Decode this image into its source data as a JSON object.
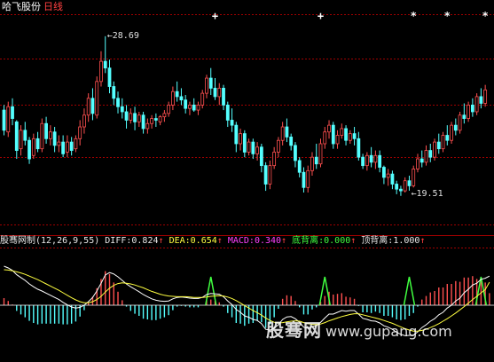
{
  "header": {
    "stock_name": "哈飞股份",
    "period": "日线"
  },
  "indicator": {
    "name": "股骞网制",
    "params": "(12,26,9,55)",
    "diff_label": "DIFF:",
    "diff_value": "0.824",
    "dea_label": "DEA:",
    "dea_value": "0.654",
    "macd_label": "MACD:",
    "macd_value": "0.340",
    "bottom_div_label": "底背离:",
    "bottom_div_value": "0.000",
    "top_div_label": "顶背离:",
    "top_div_value": "1.000",
    "up_arrow": "↑"
  },
  "watermark": {
    "cn": "股骞网",
    "url": "www.gupang.com"
  },
  "colors": {
    "up": "#ff5050",
    "down": "#54ffff",
    "grid": "#a00000",
    "diff": "#ffffff",
    "dea": "#ffff40",
    "signal": "#40ff40"
  },
  "chart_data": [
    {
      "type": "candlestick",
      "title": "",
      "ylim": [
        17.5,
        30.0
      ],
      "annotations": [
        {
          "text": "28.69",
          "value": 28.69,
          "kind": "max"
        },
        {
          "text": "19.51",
          "value": 19.51,
          "kind": "min"
        }
      ],
      "markers": [
        {
          "symbol": "+",
          "bars": [
            50,
            75
          ]
        },
        {
          "symbol": "*",
          "bars": [
            97,
            105,
            114
          ]
        }
      ],
      "ohlc": [
        [
          24.3,
          24.6,
          22.8,
          23.1
        ],
        [
          23.0,
          24.8,
          22.7,
          24.5
        ],
        [
          24.5,
          25.0,
          23.4,
          23.8
        ],
        [
          23.6,
          23.7,
          21.4,
          21.9
        ],
        [
          22.0,
          23.4,
          21.6,
          23.1
        ],
        [
          23.1,
          23.6,
          22.2,
          22.5
        ],
        [
          22.5,
          22.7,
          21.1,
          21.4
        ],
        [
          21.6,
          22.9,
          21.4,
          22.6
        ],
        [
          22.6,
          23.0,
          21.8,
          22.0
        ],
        [
          22.0,
          23.8,
          21.8,
          23.5
        ],
        [
          23.5,
          23.9,
          22.3,
          22.6
        ],
        [
          22.6,
          23.4,
          22.2,
          23.0
        ],
        [
          23.0,
          23.3,
          21.8,
          22.2
        ],
        [
          22.2,
          22.8,
          21.8,
          22.4
        ],
        [
          22.4,
          22.8,
          21.5,
          21.7
        ],
        [
          21.8,
          22.8,
          21.5,
          22.4
        ],
        [
          22.4,
          22.7,
          21.6,
          21.9
        ],
        [
          22.0,
          22.8,
          21.8,
          22.6
        ],
        [
          22.6,
          23.7,
          22.2,
          23.3
        ],
        [
          23.3,
          24.4,
          22.9,
          24.0
        ],
        [
          24.0,
          25.3,
          23.6,
          25.0
        ],
        [
          25.0,
          25.6,
          23.7,
          24.1
        ],
        [
          24.0,
          26.3,
          23.8,
          26.0
        ],
        [
          26.0,
          27.8,
          25.7,
          27.2
        ],
        [
          27.2,
          28.69,
          26.5,
          26.8
        ],
        [
          26.8,
          27.3,
          25.3,
          25.7
        ],
        [
          25.7,
          26.0,
          24.6,
          25.0
        ],
        [
          25.0,
          25.4,
          24.1,
          24.5
        ],
        [
          24.5,
          25.0,
          23.8,
          24.2
        ],
        [
          24.2,
          24.6,
          23.2,
          23.7
        ],
        [
          23.7,
          24.4,
          23.5,
          24.1
        ],
        [
          24.1,
          24.5,
          23.1,
          23.6
        ],
        [
          23.6,
          24.2,
          23.3,
          24.0
        ],
        [
          24.0,
          24.2,
          22.9,
          23.2
        ],
        [
          23.2,
          23.8,
          22.9,
          23.5
        ],
        [
          23.5,
          24.0,
          23.2,
          23.8
        ],
        [
          23.8,
          24.1,
          23.3,
          23.7
        ],
        [
          23.6,
          24.0,
          23.4,
          23.9
        ],
        [
          23.9,
          24.3,
          23.6,
          24.1
        ],
        [
          24.1,
          24.8,
          23.9,
          24.6
        ],
        [
          24.6,
          25.7,
          24.3,
          25.4
        ],
        [
          25.4,
          26.0,
          24.8,
          25.1
        ],
        [
          25.1,
          25.6,
          24.6,
          24.9
        ],
        [
          24.9,
          25.2,
          24.1,
          24.4
        ],
        [
          24.4,
          24.8,
          24.0,
          24.6
        ],
        [
          24.6,
          25.0,
          24.2,
          24.3
        ],
        [
          24.3,
          24.8,
          24.0,
          24.6
        ],
        [
          24.6,
          25.5,
          24.4,
          25.3
        ],
        [
          25.3,
          26.4,
          25.0,
          26.2
        ],
        [
          26.2,
          26.8,
          25.2,
          25.6
        ],
        [
          25.6,
          26.2,
          24.9,
          25.1
        ],
        [
          25.1,
          25.9,
          24.6,
          25.6
        ],
        [
          25.6,
          25.8,
          24.3,
          24.6
        ],
        [
          24.6,
          24.8,
          23.3,
          23.7
        ],
        [
          23.7,
          24.4,
          23.0,
          23.4
        ],
        [
          23.4,
          23.6,
          21.8,
          22.3
        ],
        [
          22.3,
          23.2,
          21.9,
          22.9
        ],
        [
          22.9,
          23.1,
          21.5,
          21.8
        ],
        [
          21.8,
          22.6,
          21.6,
          22.4
        ],
        [
          22.4,
          22.6,
          21.4,
          21.7
        ],
        [
          21.7,
          22.4,
          21.3,
          22.1
        ],
        [
          22.1,
          22.3,
          20.6,
          21.0
        ],
        [
          21.0,
          21.2,
          19.5,
          19.9
        ],
        [
          19.9,
          21.3,
          19.6,
          21.0
        ],
        [
          21.0,
          22.1,
          20.8,
          21.8
        ],
        [
          21.8,
          22.7,
          21.5,
          22.5
        ],
        [
          22.5,
          23.6,
          22.2,
          23.3
        ],
        [
          23.3,
          23.8,
          22.4,
          22.7
        ],
        [
          22.7,
          22.9,
          21.9,
          22.2
        ],
        [
          22.2,
          22.4,
          20.9,
          21.3
        ],
        [
          21.3,
          21.5,
          20.3,
          20.6
        ],
        [
          20.6,
          20.9,
          19.4,
          19.7
        ],
        [
          19.7,
          21.0,
          19.4,
          20.7
        ],
        [
          20.7,
          21.8,
          20.4,
          21.5
        ],
        [
          21.5,
          22.3,
          20.8,
          21.1
        ],
        [
          21.1,
          22.6,
          20.9,
          22.3
        ],
        [
          22.3,
          23.3,
          22.0,
          23.0
        ],
        [
          23.0,
          23.7,
          22.6,
          23.4
        ],
        [
          23.4,
          23.6,
          22.0,
          22.3
        ],
        [
          22.3,
          23.1,
          22.0,
          22.8
        ],
        [
          22.8,
          23.5,
          22.6,
          23.2
        ],
        [
          23.2,
          23.4,
          22.2,
          22.5
        ],
        [
          22.5,
          23.1,
          22.3,
          22.9
        ],
        [
          22.9,
          23.3,
          22.2,
          22.6
        ],
        [
          22.6,
          23.0,
          21.3,
          21.5
        ],
        [
          21.5,
          21.7,
          20.8,
          21.0
        ],
        [
          21.0,
          21.8,
          20.7,
          21.6
        ],
        [
          21.6,
          22.1,
          20.9,
          21.2
        ],
        [
          21.2,
          21.9,
          20.8,
          21.6
        ],
        [
          21.6,
          21.9,
          20.6,
          20.9
        ],
        [
          20.9,
          21.0,
          19.9,
          20.3
        ],
        [
          20.3,
          20.8,
          19.8,
          20.5
        ],
        [
          20.5,
          20.7,
          19.6,
          19.9
        ],
        [
          19.9,
          20.1,
          19.3,
          19.6
        ],
        [
          19.6,
          19.8,
          19.2,
          19.5
        ],
        [
          19.5,
          20.3,
          19.4,
          20.1
        ],
        [
          20.1,
          20.4,
          19.51,
          19.8
        ],
        [
          19.8,
          21.0,
          19.7,
          20.8
        ],
        [
          20.8,
          21.7,
          20.6,
          21.4
        ],
        [
          21.4,
          21.9,
          20.9,
          21.2
        ],
        [
          21.2,
          22.2,
          21.0,
          21.9
        ],
        [
          21.9,
          22.3,
          21.2,
          21.5
        ],
        [
          21.5,
          22.6,
          21.3,
          22.4
        ],
        [
          22.4,
          22.9,
          21.7,
          22.0
        ],
        [
          22.0,
          23.0,
          21.8,
          22.8
        ],
        [
          22.8,
          23.4,
          22.2,
          22.5
        ],
        [
          22.5,
          23.6,
          22.3,
          23.4
        ],
        [
          23.4,
          23.8,
          22.8,
          23.1
        ],
        [
          23.1,
          24.2,
          22.9,
          24.0
        ],
        [
          24.0,
          24.7,
          23.5,
          23.8
        ],
        [
          23.8,
          24.8,
          23.6,
          24.6
        ],
        [
          24.6,
          25.0,
          23.9,
          24.2
        ],
        [
          24.2,
          25.3,
          24.0,
          25.1
        ],
        [
          25.1,
          25.6,
          24.4,
          24.7
        ],
        [
          24.7,
          25.8,
          24.5,
          25.5
        ]
      ]
    },
    {
      "type": "macd",
      "ylim": [
        -1.5,
        1.6
      ],
      "series": [
        {
          "name": "DIFF",
          "final": 0.824
        },
        {
          "name": "DEA",
          "final": 0.654
        },
        {
          "name": "MACD",
          "final": 0.34
        }
      ],
      "diff": [
        1.1,
        1.05,
        0.98,
        0.86,
        0.78,
        0.7,
        0.6,
        0.52,
        0.45,
        0.4,
        0.34,
        0.28,
        0.22,
        0.16,
        0.08,
        0.01,
        -0.05,
        -0.08,
        -0.06,
        0.0,
        0.1,
        0.22,
        0.4,
        0.62,
        0.85,
        0.92,
        0.88,
        0.8,
        0.7,
        0.6,
        0.52,
        0.45,
        0.38,
        0.3,
        0.24,
        0.18,
        0.14,
        0.12,
        0.11,
        0.12,
        0.18,
        0.22,
        0.23,
        0.22,
        0.2,
        0.19,
        0.19,
        0.22,
        0.3,
        0.33,
        0.32,
        0.31,
        0.24,
        0.12,
        0.02,
        -0.12,
        -0.2,
        -0.3,
        -0.34,
        -0.4,
        -0.43,
        -0.52,
        -0.68,
        -0.7,
        -0.65,
        -0.55,
        -0.4,
        -0.33,
        -0.32,
        -0.38,
        -0.48,
        -0.62,
        -0.65,
        -0.6,
        -0.58,
        -0.48,
        -0.36,
        -0.25,
        -0.25,
        -0.2,
        -0.15,
        -0.17,
        -0.15,
        -0.15,
        -0.25,
        -0.37,
        -0.4,
        -0.44,
        -0.45,
        -0.5,
        -0.58,
        -0.62,
        -0.68,
        -0.76,
        -0.82,
        -0.86,
        -0.85,
        -0.84,
        -0.75,
        -0.63,
        -0.55,
        -0.45,
        -0.38,
        -0.27,
        -0.2,
        -0.08,
        0.0,
        0.12,
        0.2,
        0.35,
        0.45,
        0.57,
        0.62,
        0.73,
        0.76,
        0.82
      ],
      "dea": [
        1.0,
        0.99,
        0.97,
        0.94,
        0.91,
        0.87,
        0.82,
        0.77,
        0.72,
        0.66,
        0.6,
        0.54,
        0.48,
        0.42,
        0.35,
        0.28,
        0.21,
        0.15,
        0.1,
        0.07,
        0.07,
        0.1,
        0.16,
        0.25,
        0.37,
        0.48,
        0.56,
        0.61,
        0.63,
        0.62,
        0.6,
        0.57,
        0.53,
        0.49,
        0.44,
        0.39,
        0.35,
        0.31,
        0.28,
        0.26,
        0.25,
        0.24,
        0.24,
        0.24,
        0.23,
        0.22,
        0.22,
        0.22,
        0.23,
        0.25,
        0.26,
        0.27,
        0.26,
        0.23,
        0.19,
        0.13,
        0.06,
        -0.01,
        -0.08,
        -0.15,
        -0.21,
        -0.28,
        -0.36,
        -0.43,
        -0.48,
        -0.5,
        -0.49,
        -0.47,
        -0.45,
        -0.44,
        -0.45,
        -0.49,
        -0.52,
        -0.54,
        -0.55,
        -0.53,
        -0.49,
        -0.44,
        -0.4,
        -0.36,
        -0.32,
        -0.29,
        -0.26,
        -0.24,
        -0.24,
        -0.27,
        -0.3,
        -0.33,
        -0.36,
        -0.39,
        -0.43,
        -0.47,
        -0.51,
        -0.56,
        -0.61,
        -0.66,
        -0.7,
        -0.73,
        -0.73,
        -0.71,
        -0.68,
        -0.63,
        -0.58,
        -0.52,
        -0.45,
        -0.38,
        -0.3,
        -0.22,
        -0.13,
        -0.04,
        0.06,
        0.16,
        0.25,
        0.35,
        0.44,
        0.65
      ],
      "macd": [
        0.2,
        0.12,
        0.02,
        -0.16,
        -0.26,
        -0.34,
        -0.44,
        -0.5,
        -0.54,
        -0.52,
        -0.52,
        -0.52,
        -0.52,
        -0.52,
        -0.54,
        -0.54,
        -0.52,
        -0.46,
        -0.32,
        -0.14,
        0.06,
        0.24,
        0.48,
        0.74,
        0.96,
        0.88,
        0.64,
        0.38,
        0.14,
        -0.04,
        -0.16,
        -0.24,
        -0.3,
        -0.38,
        -0.4,
        -0.42,
        -0.42,
        -0.38,
        -0.34,
        -0.28,
        -0.14,
        -0.04,
        -0.02,
        -0.04,
        -0.06,
        -0.06,
        -0.06,
        0.0,
        0.14,
        0.16,
        0.12,
        0.08,
        -0.04,
        -0.22,
        -0.34,
        -0.5,
        -0.52,
        -0.58,
        -0.52,
        -0.5,
        -0.44,
        -0.48,
        -0.64,
        -0.54,
        -0.34,
        -0.1,
        0.18,
        0.28,
        0.26,
        0.12,
        -0.06,
        -0.26,
        -0.26,
        -0.12,
        -0.06,
        0.1,
        0.26,
        0.38,
        0.3,
        0.32,
        0.34,
        0.24,
        0.22,
        0.18,
        -0.02,
        -0.2,
        -0.2,
        -0.22,
        -0.18,
        -0.22,
        -0.3,
        -0.3,
        -0.34,
        -0.4,
        -0.42,
        -0.4,
        -0.3,
        -0.22,
        -0.04,
        0.16,
        0.26,
        0.36,
        0.4,
        0.5,
        0.5,
        0.6,
        0.6,
        0.68,
        0.66,
        0.78,
        0.78,
        0.82,
        0.74,
        0.76,
        0.64,
        0.34
      ],
      "bottom_div_spikes": [
        49,
        76,
        96
      ],
      "top_div_spikes": [
        113
      ]
    }
  ]
}
